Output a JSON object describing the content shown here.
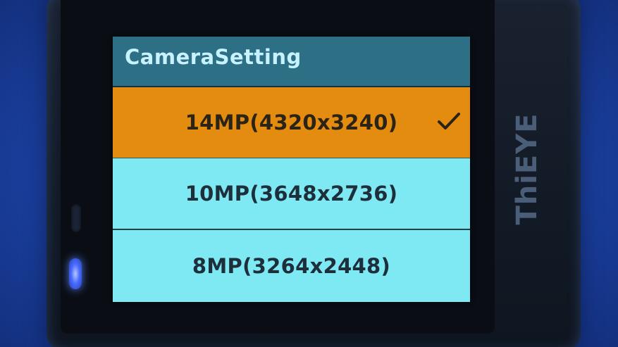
{
  "screen": {
    "title": "CameraSetting"
  },
  "options": [
    {
      "label": "14MP(4320x3240)",
      "selected": true
    },
    {
      "label": "10MP(3648x2736)",
      "selected": false
    },
    {
      "label": "8MP(3264x2448)",
      "selected": false
    }
  ],
  "device": {
    "brand": "ThiEYE"
  },
  "colors": {
    "header": "#2d6f85",
    "title_text": "#c8f2ff",
    "selected_row": "#e48c10",
    "unselected_row": "#7ee9f3",
    "option_text": "#1e2f3c",
    "status_light": "#4a6cff"
  },
  "icons": {
    "selected_marker": "checkmark-icon"
  }
}
